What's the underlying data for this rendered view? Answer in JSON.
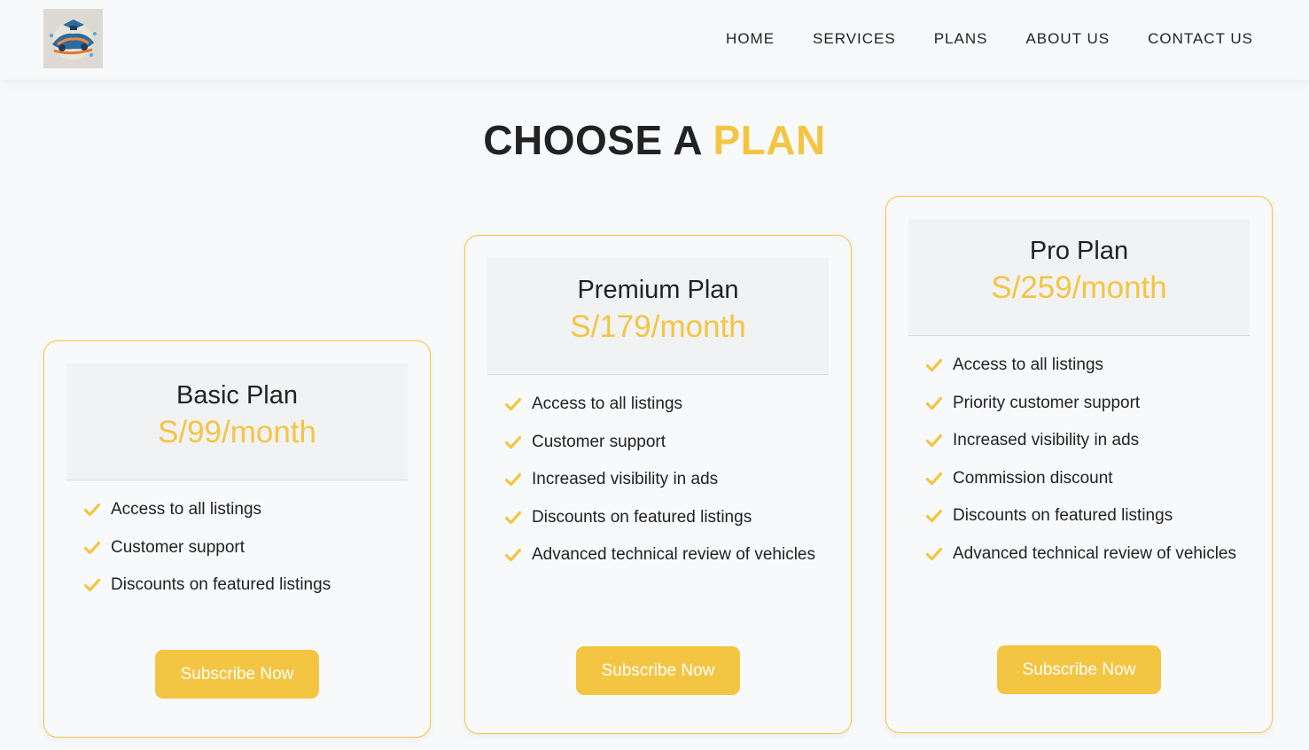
{
  "header": {
    "logo_alt": "car logo",
    "nav": [
      "HOME",
      "SERVICES",
      "PLANS",
      "ABOUT US",
      "CONTACT US"
    ]
  },
  "section": {
    "title_main": "CHOOSE A",
    "title_accent": "PLAN"
  },
  "plans": [
    {
      "name": "Basic Plan",
      "price": "S/99/month",
      "features": [
        "Access to all listings",
        "Customer support",
        "Discounts on featured listings"
      ],
      "button": "Subscribe Now"
    },
    {
      "name": "Premium Plan",
      "price": "S/179/month",
      "features": [
        "Access to all listings",
        "Customer support",
        "Increased visibility in ads",
        "Discounts on featured listings",
        "Advanced technical review of vehicles"
      ],
      "button": "Subscribe Now"
    },
    {
      "name": "Pro Plan",
      "price": "S/259/month",
      "features": [
        "Access to all listings",
        "Priority customer support",
        "Increased visibility in ads",
        "Commission discount",
        "Discounts on featured listings",
        "Advanced technical review of vehicles"
      ],
      "button": "Subscribe Now"
    }
  ],
  "colors": {
    "accent": "#f4c542",
    "text": "#222222",
    "background": "#f8f9fa"
  },
  "icons": {
    "feature_bullet": "check-icon"
  }
}
